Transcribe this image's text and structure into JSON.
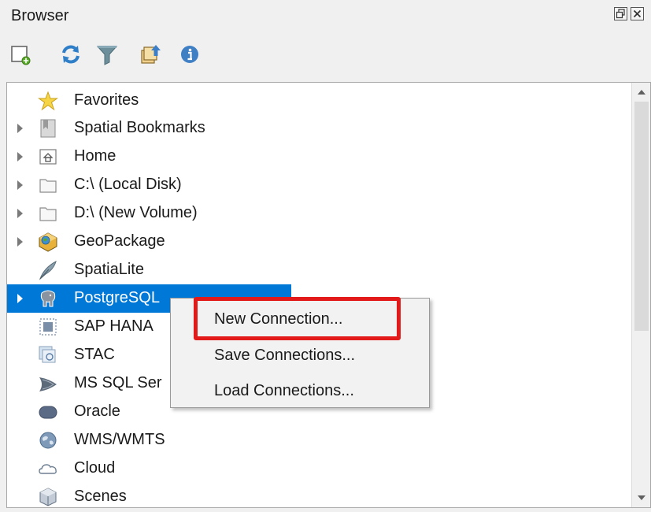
{
  "panel": {
    "title": "Browser"
  },
  "window_buttons": [
    {
      "name": "float-panel-icon"
    },
    {
      "name": "close-panel-icon"
    }
  ],
  "toolbar": [
    {
      "icon": "add-selected-layers-icon"
    },
    {
      "icon": "refresh-icon"
    },
    {
      "icon": "filter-icon"
    },
    {
      "icon": "collapse-all-icon"
    },
    {
      "icon": "properties-info-icon"
    }
  ],
  "tree": {
    "items": [
      {
        "label": "Favorites",
        "icon": "star-icon",
        "expandable": false,
        "selected": false
      },
      {
        "label": "Spatial Bookmarks",
        "icon": "bookmark-icon",
        "expandable": true,
        "selected": false
      },
      {
        "label": "Home",
        "icon": "home-folder-icon",
        "expandable": true,
        "selected": false
      },
      {
        "label": "C:\\ (Local Disk)",
        "icon": "folder-icon",
        "expandable": true,
        "selected": false
      },
      {
        "label": "D:\\ (New Volume)",
        "icon": "folder-icon",
        "expandable": true,
        "selected": false
      },
      {
        "label": "GeoPackage",
        "icon": "geopackage-icon",
        "expandable": true,
        "selected": false
      },
      {
        "label": "SpatiaLite",
        "icon": "spatialite-feather-icon",
        "expandable": false,
        "selected": false
      },
      {
        "label": "PostgreSQL",
        "icon": "postgresql-elephant-icon",
        "expandable": true,
        "selected": true
      },
      {
        "label": "SAP HANA",
        "icon": "sap-hana-icon",
        "expandable": false,
        "selected": false
      },
      {
        "label": "STAC",
        "icon": "stac-icon",
        "expandable": false,
        "selected": false
      },
      {
        "label": "MS SQL Ser",
        "icon": "mssql-icon",
        "expandable": false,
        "selected": false
      },
      {
        "label": "Oracle",
        "icon": "oracle-icon",
        "expandable": false,
        "selected": false
      },
      {
        "label": "WMS/WMTS",
        "icon": "globe-icon",
        "expandable": false,
        "selected": false
      },
      {
        "label": "Cloud",
        "icon": "cloud-icon",
        "expandable": false,
        "selected": false
      },
      {
        "label": "Scenes",
        "icon": "scenes-cube-icon",
        "expandable": false,
        "selected": false
      }
    ]
  },
  "context_menu": {
    "items": [
      {
        "label": "New Connection..."
      },
      {
        "label": "Save Connections..."
      },
      {
        "label": "Load Connections..."
      }
    ],
    "highlighted_item": "New Connection...",
    "highlight_color": "#e31a1a"
  },
  "colors": {
    "selection": "#0078d7",
    "background": "#f0f0f0",
    "tree_background": "#ffffff"
  }
}
